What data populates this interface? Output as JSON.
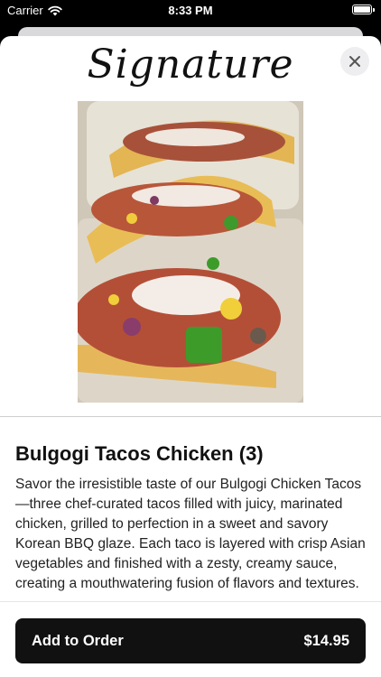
{
  "status_bar": {
    "carrier": "Carrier",
    "time": "8:33 PM"
  },
  "header": {
    "logo_text": "Signature"
  },
  "item": {
    "title": "Bulgogi Tacos Chicken (3)",
    "description": "Savor the irresistible taste of our Bulgogi Chicken Tacos—three chef-curated tacos filled with juicy, marinated chicken, grilled to perfection in a sweet and savory Korean BBQ glaze. Each taco is layered with crisp Asian vegetables and finished with a zesty, creamy sauce, creating a mouthwatering fusion of flavors and textures."
  },
  "order_button": {
    "label": "Add to Order",
    "price": "$14.95"
  },
  "icons": {
    "close": "close-icon",
    "wifi": "wifi-icon",
    "battery": "battery-icon"
  },
  "colors": {
    "button_bg": "#111111",
    "sheet_bg": "#ffffff",
    "close_bg": "#eeeef0"
  }
}
